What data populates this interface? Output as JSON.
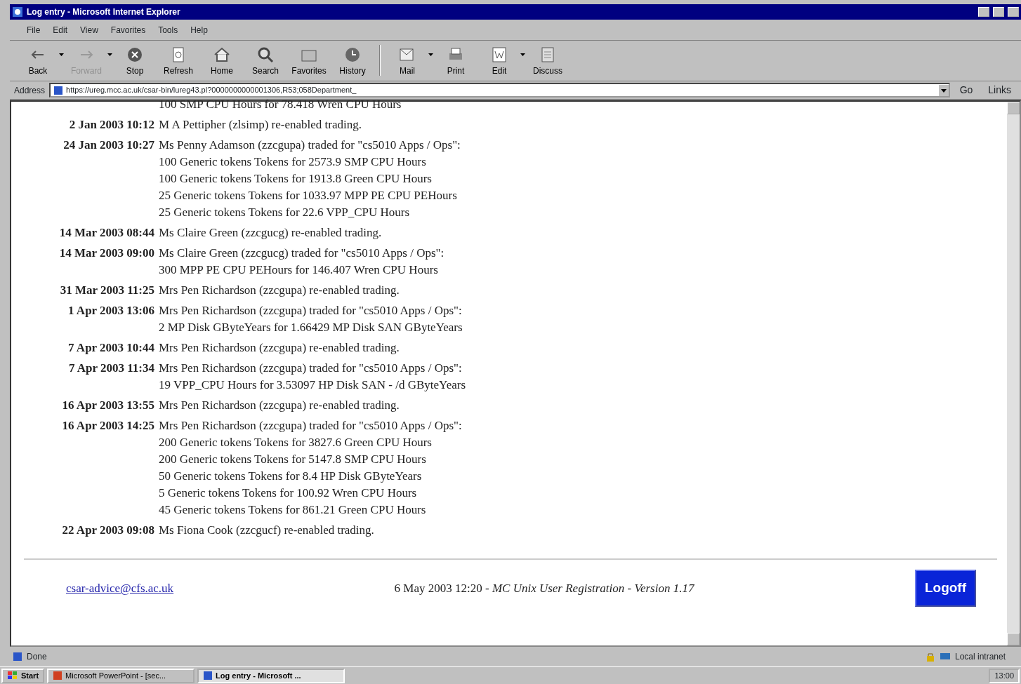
{
  "window": {
    "title": "Log entry - Microsoft Internet Explorer"
  },
  "menu": [
    "File",
    "Edit",
    "View",
    "Favorites",
    "Tools",
    "Help"
  ],
  "toolbar": [
    {
      "label": "Back",
      "disabled": false,
      "dropdown": true
    },
    {
      "label": "Forward",
      "disabled": true,
      "dropdown": true
    },
    {
      "label": "Stop",
      "disabled": false,
      "dropdown": false
    },
    {
      "label": "Refresh",
      "disabled": false,
      "dropdown": false
    },
    {
      "label": "Home",
      "disabled": false,
      "dropdown": false
    },
    {
      "label": "Search",
      "disabled": false,
      "dropdown": false
    },
    {
      "label": "Favorites",
      "disabled": false,
      "dropdown": false
    },
    {
      "label": "History",
      "disabled": false,
      "dropdown": false
    },
    {
      "label": "Mail",
      "disabled": false,
      "dropdown": true
    },
    {
      "label": "Print",
      "disabled": false,
      "dropdown": false
    },
    {
      "label": "Edit",
      "disabled": false,
      "dropdown": true
    },
    {
      "label": "Discuss",
      "disabled": false,
      "dropdown": false
    }
  ],
  "address_bar": {
    "label": "Address",
    "value": "https://ureg.mcc.ac.uk/csar-bin/lureg43.pl?0000000000001306,R53;058Department_",
    "go": "Go",
    "links": "Links"
  },
  "log_entries": [
    {
      "details": [
        "100 SMP CPU Hours for 78.418 Wren CPU Hours"
      ]
    },
    {
      "date": "2 Jan 2003 10:12",
      "text": "M A Pettipher (zlsimp) re-enabled trading."
    },
    {
      "date": "24 Jan 2003 10:27",
      "text": "Ms Penny Adamson (zzcgupa) traded for \"cs5010 Apps / Ops\":",
      "details": [
        "100 Generic tokens Tokens for 2573.9 SMP CPU Hours",
        "100 Generic tokens Tokens for 1913.8 Green CPU Hours",
        "25 Generic tokens Tokens for 1033.97 MPP PE CPU PEHours",
        "25 Generic tokens Tokens for 22.6 VPP_CPU Hours"
      ]
    },
    {
      "date": "14 Mar 2003 08:44",
      "text": "Ms Claire Green (zzcgucg) re-enabled trading."
    },
    {
      "date": "14 Mar 2003 09:00",
      "text": "Ms Claire Green (zzcgucg) traded for \"cs5010 Apps / Ops\":",
      "details": [
        "300 MPP PE CPU PEHours for 146.407 Wren CPU Hours"
      ]
    },
    {
      "date": "31 Mar 2003 11:25",
      "text": "Mrs Pen Richardson (zzcgupa) re-enabled trading."
    },
    {
      "date": "1 Apr 2003 13:06",
      "text": "Mrs Pen Richardson (zzcgupa) traded for \"cs5010 Apps / Ops\":",
      "details": [
        "2 MP Disk GByteYears for 1.66429 MP Disk SAN GByteYears"
      ]
    },
    {
      "date": "7 Apr 2003 10:44",
      "text": "Mrs Pen Richardson (zzcgupa) re-enabled trading."
    },
    {
      "date": "7 Apr 2003 11:34",
      "text": "Mrs Pen Richardson (zzcgupa) traded for \"cs5010 Apps / Ops\":",
      "details": [
        "19 VPP_CPU Hours for 3.53097 HP Disk SAN - /d GByteYears"
      ]
    },
    {
      "date": "16 Apr 2003 13:55",
      "text": "Mrs Pen Richardson (zzcgupa) re-enabled trading."
    },
    {
      "date": "16 Apr 2003 14:25",
      "text": "Mrs Pen Richardson (zzcgupa) traded for \"cs5010 Apps / Ops\":",
      "details": [
        "200 Generic tokens Tokens for 3827.6 Green CPU Hours",
        "200 Generic tokens Tokens for 5147.8 SMP CPU Hours",
        "50 Generic tokens Tokens for 8.4 HP Disk GByteYears",
        "5 Generic tokens Tokens for 100.92 Wren CPU Hours",
        "45 Generic tokens Tokens for 861.21 Green CPU Hours"
      ]
    },
    {
      "date": "22 Apr 2003 09:08",
      "text": "Ms Fiona Cook (zzcgucf) re-enabled trading."
    }
  ],
  "footer": {
    "email": "csar-advice@cfs.ac.uk",
    "info": "6 May 2003 12:20 - *MC Unix User Registration - Version 1.17*",
    "logoff": "Logoff"
  },
  "status_bar": {
    "status": "Done",
    "zone": "Local intranet"
  },
  "taskbar": {
    "start": "Start",
    "tasks": [
      {
        "label": "Microsoft PowerPoint - [sec...",
        "selected": false
      },
      {
        "label": "Log entry - Microsoft ...",
        "selected": true
      }
    ],
    "clock": "13:00"
  }
}
